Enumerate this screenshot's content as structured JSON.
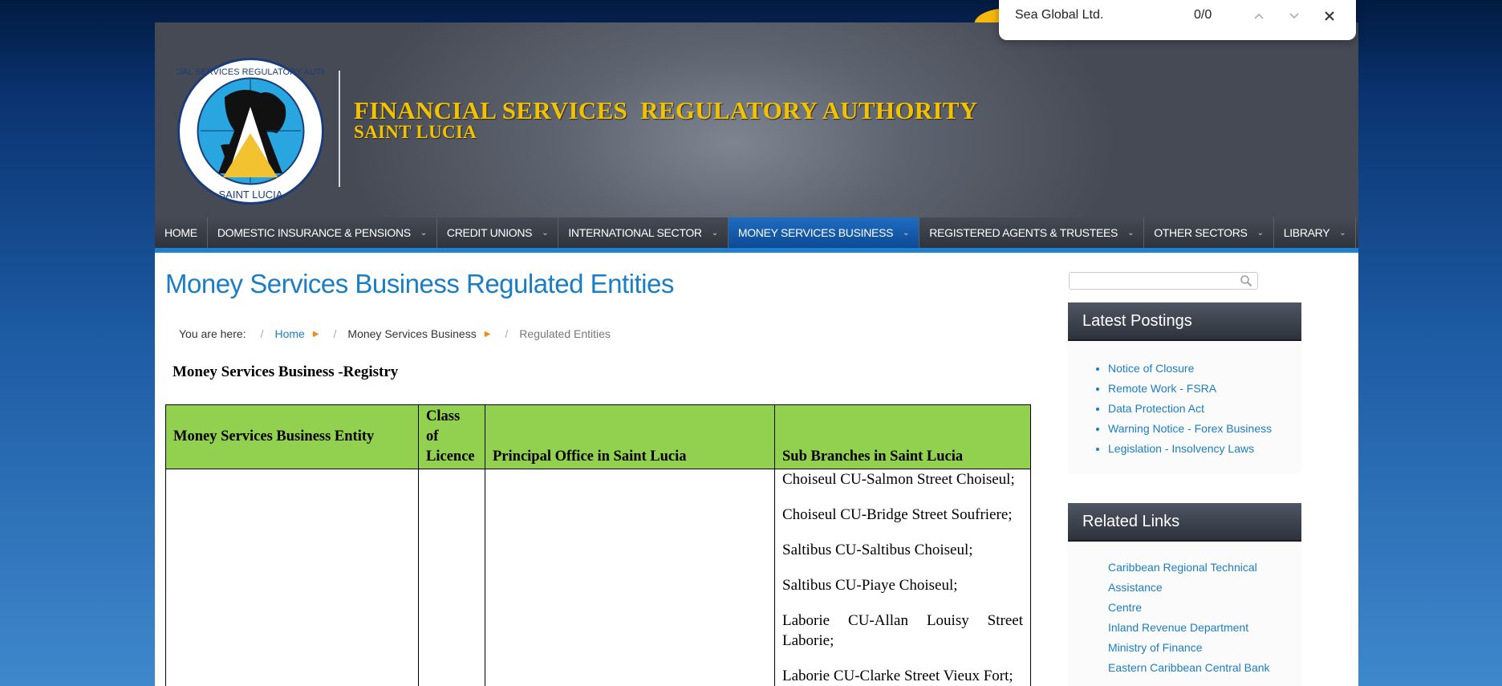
{
  "header": {
    "title": "FINANCIAL SERVICES  REGULATORY AUTHORITY",
    "subtitle": "SAINT LUCIA",
    "logo_ring_text": "FINANCIAL SERVICES REGULATORY AUTHORITY",
    "logo_bottom_text": "SAINT LUCIA"
  },
  "nav": {
    "items": [
      {
        "label": "HOME",
        "has_dropdown": false
      },
      {
        "label": "DOMESTIC INSURANCE & PENSIONS",
        "has_dropdown": true
      },
      {
        "label": "CREDIT UNIONS",
        "has_dropdown": true
      },
      {
        "label": "INTERNATIONAL SECTOR",
        "has_dropdown": true
      },
      {
        "label": "MONEY SERVICES BUSINESS",
        "has_dropdown": true,
        "active": true
      },
      {
        "label": "REGISTERED AGENTS & TRUSTEES",
        "has_dropdown": true
      },
      {
        "label": "OTHER SECTORS",
        "has_dropdown": true
      },
      {
        "label": "LIBRARY",
        "has_dropdown": true
      }
    ]
  },
  "main": {
    "page_title": "Money Services Business Regulated Entities",
    "breadcrumb": {
      "prefix": "You are here:",
      "items": [
        "Home",
        "Money Services Business",
        "Regulated Entities"
      ]
    },
    "registry_heading": "Money Services Business -Registry",
    "table": {
      "headers": [
        "Money Services Business Entity",
        "Class of Licence",
        "Principal Office in Saint Lucia",
        "Sub Branches in Saint Lucia"
      ],
      "class_of_licence_lines": [
        "Class",
        "of",
        "Licence"
      ],
      "row": {
        "entity": "",
        "class": "",
        "principal_office": "",
        "sub_branches": [
          "Choiseul CU-Salmon Street Choiseul;",
          "Choiseul CU-Bridge Street Soufriere;",
          "Saltibus CU-Saltibus Choiseul;",
          "Saltibus CU-Piaye Choiseul;",
          "Laborie CU-Allan Louisy Street Laborie;",
          "Laborie CU-Clarke Street Vieux Fort;"
        ]
      }
    }
  },
  "sidebar": {
    "search": {
      "value": "",
      "placeholder": ""
    },
    "latest_postings": {
      "title": "Latest Postings",
      "items": [
        "Notice of Closure",
        "Remote Work - FSRA",
        "Data Protection Act",
        "Warning Notice - Forex Business",
        "Legislation - Insolvency Laws"
      ]
    },
    "related_links": {
      "title": "Related Links",
      "items": [
        "Caribbean Regional Technical Assistance",
        "Centre",
        "Inland Revenue Department",
        "Ministry of Finance",
        "Eastern Caribbean Central Bank"
      ]
    }
  },
  "findbar": {
    "query": "Sea Global Ltd.",
    "count": "0/0",
    "icons": [
      "chevron-up-icon",
      "chevron-down-icon",
      "close-icon"
    ]
  },
  "colors": {
    "accent_blue": "#1b7dc4",
    "title_gold": "#f2c200",
    "table_header_green": "#92d050",
    "nav_active": "#0d4a94",
    "breadcrumb_arrow": "#f08c1a"
  }
}
